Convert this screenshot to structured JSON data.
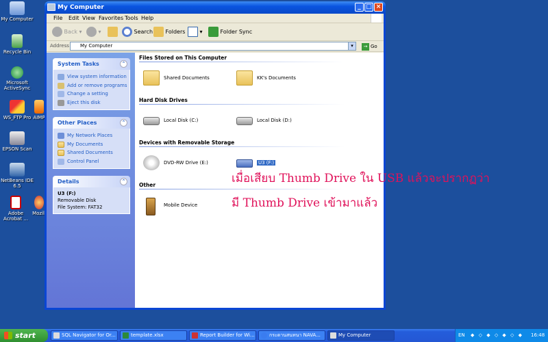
{
  "desktop": {
    "icons": [
      {
        "label": "My Computer"
      },
      {
        "label": "Recycle Bin"
      },
      {
        "label": "Microsoft ActiveSync"
      },
      {
        "label": "WS_FTP Pro"
      },
      {
        "label": "EPSON Scan"
      },
      {
        "label": "NetBeans IDE 6.5"
      },
      {
        "label": "Adobe Acrobat ..."
      },
      {
        "label": "AIMP"
      },
      {
        "label": "Mozill"
      }
    ]
  },
  "window": {
    "title": "My Computer",
    "menu": [
      "File",
      "Edit",
      "View",
      "Favorites",
      "Tools",
      "Help"
    ],
    "toolbar": {
      "back": "Back",
      "search": "Search",
      "folders": "Folders",
      "folder_sync": "Folder Sync"
    },
    "address": {
      "label": "Address",
      "value": "My Computer",
      "go": "Go"
    },
    "left": {
      "system_tasks": {
        "title": "System Tasks",
        "items": [
          "View system information",
          "Add or remove programs",
          "Change a setting",
          "Eject this disk"
        ]
      },
      "other_places": {
        "title": "Other Places",
        "items": [
          "My Network Places",
          "My Documents",
          "Shared Documents",
          "Control Panel"
        ]
      },
      "details": {
        "title": "Details",
        "name": "U3 (F:)",
        "type": "Removable Disk",
        "fs": "File System: FAT32"
      }
    },
    "groups": {
      "stored": {
        "title": "Files Stored on This Computer",
        "items": [
          "Shared Documents",
          "KK's Documents"
        ]
      },
      "hdd": {
        "title": "Hard Disk Drives",
        "items": [
          "Local Disk (C:)",
          "Local Disk (D:)"
        ]
      },
      "removable": {
        "title": "Devices with Removable Storage",
        "items": [
          "DVD-RW Drive (E:)",
          "U3 (F:)"
        ]
      },
      "other": {
        "title": "Other",
        "items": [
          "Mobile Device"
        ]
      }
    },
    "annotation": {
      "line1": "เมื่อเสียบ Thumb Drive ใน USB แล้วจะปรากฏว่า",
      "line2": "มี Thumb Drive เข้ามาแล้ว"
    }
  },
  "taskbar": {
    "start": "start",
    "buttons": [
      "SQL Navigator for Or...",
      "template.xlsx",
      "Report Builder for Wi...",
      "กระดานสนทนา NAVA...",
      "My Computer"
    ],
    "tray": {
      "lang": "EN",
      "clock": "16:48"
    }
  },
  "colors": {
    "desktop": "#1c4f9d",
    "annotation": "#e0125a",
    "selection": "#316ac5"
  }
}
